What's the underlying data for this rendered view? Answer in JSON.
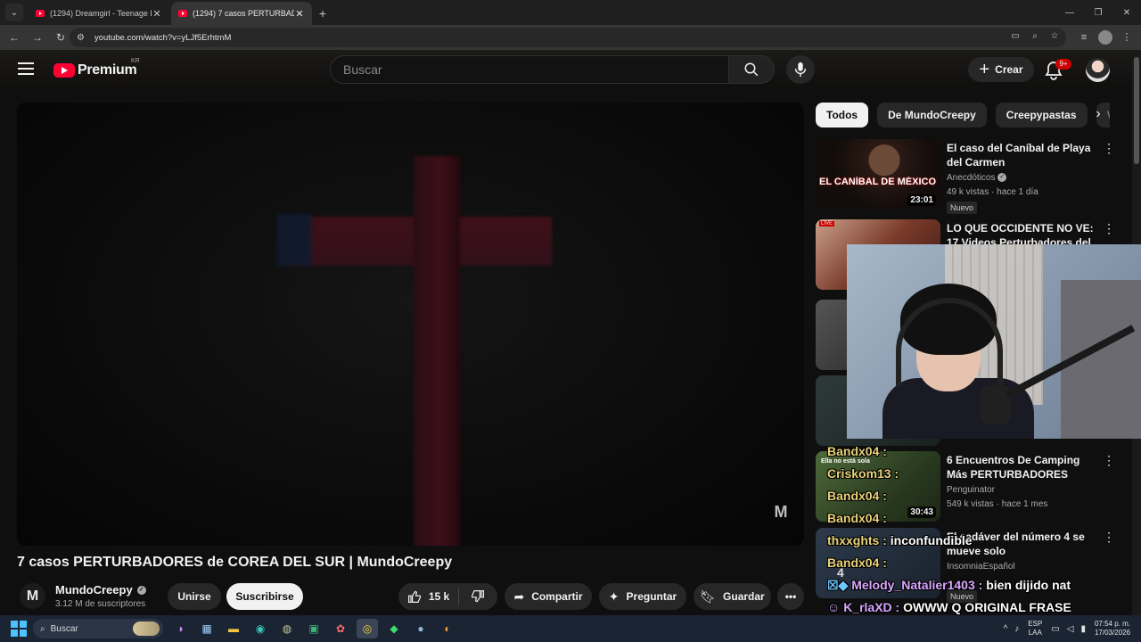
{
  "browser": {
    "tabs": [
      {
        "title": "(1294) Dreamgirl - Teenage Blu",
        "active": false
      },
      {
        "title": "(1294) 7 casos PERTURBADORES",
        "active": true
      }
    ],
    "url": "youtube.com/watch?v=yLJf5ErhtmM"
  },
  "youtube": {
    "logo_text": "Premium",
    "region": "KR",
    "search_placeholder": "Buscar",
    "create_label": "Crear",
    "notification_count": "9+"
  },
  "video": {
    "title": "7 casos PERTURBADORES de COREA DEL SUR | MundoCreepy",
    "channel": "MundoCreepy",
    "channel_logo_letter": "M",
    "subscribers": "3.12 M de suscriptores",
    "join_label": "Unirse",
    "subscribe_label": "Suscribirse",
    "likes": "15 k",
    "share_label": "Compartir",
    "ask_label": "Preguntar",
    "save_label": "Guardar"
  },
  "chips": [
    "Todos",
    "De MundoCreepy",
    "Creepypastas",
    "V"
  ],
  "recommendations": [
    {
      "title": "El caso del Caníbal de Playa del Carmen",
      "channel": "Anecdóticos",
      "meta": "49 k vistas · hace 1 día",
      "badge": "Nuevo",
      "duration": "23:01",
      "thumb_text": "EL CANÍBAL DE MÉXICO"
    },
    {
      "title": "LO QUE OCCIDENTE NO VE: 17 Videos Perturbadores del",
      "channel": "",
      "meta": "",
      "badge": "",
      "duration": "",
      "thumb_text": "LIVE"
    },
    {
      "title": "6 Encuentros De Camping Más PERTURBADORES",
      "channel": "Penguinator",
      "meta": "549 k vistas · hace 1 mes",
      "badge": "",
      "duration": "30:43",
      "thumb_text": "Ella no está sola"
    },
    {
      "title": "El cadáver del número 4 se mueve solo",
      "channel": "InsomniaEspañol",
      "meta": "",
      "badge": "Nuevo",
      "duration": "",
      "thumb_text": "4"
    }
  ],
  "chat": [
    {
      "user": "Bandx04 :",
      "msg": ""
    },
    {
      "user": "Criskom13 :",
      "msg": ""
    },
    {
      "user": "Bandx04 :",
      "msg": ""
    },
    {
      "user": "Bandx04 :",
      "msg": ""
    },
    {
      "user": "thxxghts :",
      "msg": "inconfundible"
    },
    {
      "user": "Bandx04 :",
      "msg": ""
    },
    {
      "user": "Melody_Natalier1403 :",
      "msg": "bien dijido nat"
    },
    {
      "user": "K_rlaXD :",
      "msg": "OWWW Q ORIGINAL FRASE"
    }
  ],
  "taskbar": {
    "search_label": "Buscar",
    "lang": "ESP",
    "lang2": "LAA",
    "time": "07:54 p. m.",
    "date": "17/03/2026"
  }
}
